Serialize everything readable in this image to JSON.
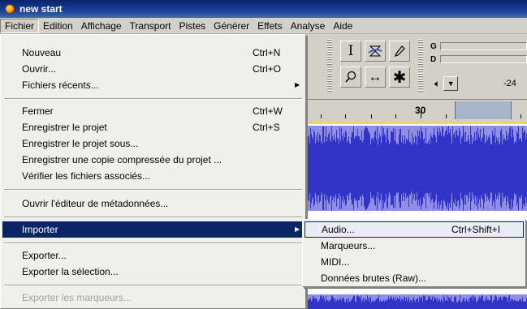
{
  "window": {
    "title": "new start"
  },
  "menubar": {
    "items": [
      "Fichier",
      "Edition",
      "Affichage",
      "Transport",
      "Pistes",
      "Générer",
      "Effets",
      "Analyse",
      "Aide"
    ],
    "active": "Fichier"
  },
  "fichier_menu": {
    "nouveau": "Nouveau",
    "nouveau_sc": "Ctrl+N",
    "ouvrir": "Ouvrir...",
    "ouvrir_sc": "Ctrl+O",
    "fichiers_recents": "Fichiers récents...",
    "fermer": "Fermer",
    "fermer_sc": "Ctrl+W",
    "enregistrer_projet": "Enregistrer le projet",
    "enregistrer_projet_sc": "Ctrl+S",
    "enregistrer_sous": "Enregistrer le projet sous...",
    "enregistrer_copie": "Enregistrer une copie compressée du projet ...",
    "verifier": "Vérifier les fichiers associés...",
    "metadonnees": "Ouvrir l'éditeur de métadonnées...",
    "importer": "Importer",
    "exporter": "Exporter...",
    "exporter_selection": "Exporter la sélection...",
    "exporter_marqueurs": "Exporter les marqueurs..."
  },
  "importer_submenu": {
    "audio": "Audio...",
    "audio_sc": "Ctrl+Shift+I",
    "marqueurs": "Marqueurs...",
    "midi": "MIDI...",
    "raw": "Données brutes (Raw)..."
  },
  "meters": {
    "playback_label": "G",
    "record_label": "D"
  },
  "volume": {
    "db_label": "-24"
  },
  "ruler": {
    "label": "30"
  },
  "colors": {
    "titlebar": "#0a246a",
    "highlight": "#0a246a",
    "waveform": "#3233c8"
  }
}
